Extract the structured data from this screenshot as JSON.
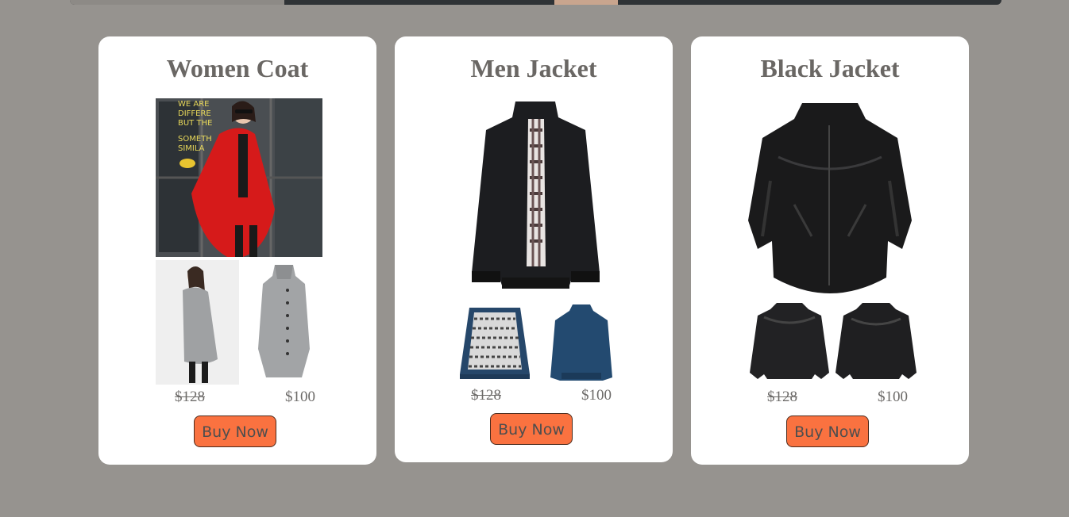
{
  "products": [
    {
      "title": "Women Coat",
      "images": [
        "red-coat-photo",
        "grey-coat-model-photo",
        "grey-coat-product-photo"
      ],
      "old_price": "$128",
      "new_price": "$100",
      "buy_label": "Buy Now"
    },
    {
      "title": "Men Jacket",
      "images": [
        "black-bomber-jacket-photo",
        "navy-jacket-inside-photo",
        "navy-jacket-back-photo"
      ],
      "old_price": "$128",
      "new_price": "$100",
      "buy_label": "Buy Now"
    },
    {
      "title": "Black Jacket",
      "images": [
        "black-leather-jacket-photo",
        "leather-jacket-front-photo",
        "leather-jacket-back-photo"
      ],
      "old_price": "$128",
      "new_price": "$100",
      "buy_label": "Buy Now"
    }
  ],
  "colors": {
    "page_background": "#96938f",
    "card_background": "#ffffff",
    "button": "#fa7240",
    "title_text": "#6a6764"
  }
}
